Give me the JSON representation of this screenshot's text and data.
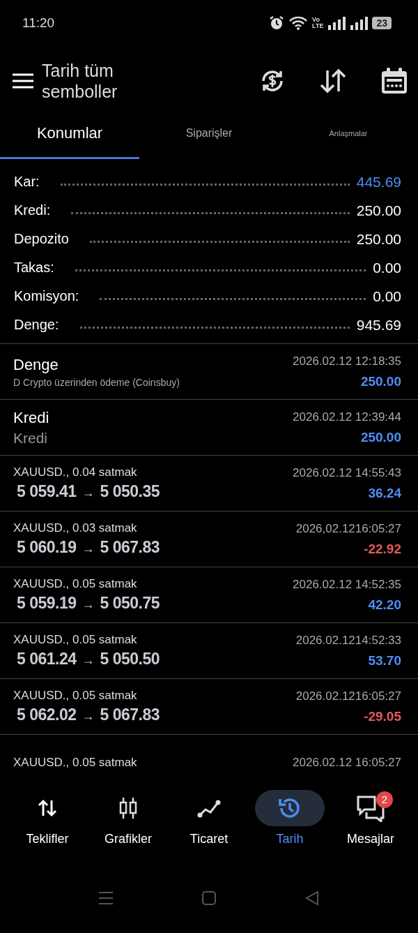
{
  "status_bar": {
    "time": "11:20",
    "network": [
      "Vo",
      "LTE"
    ],
    "battery": "23"
  },
  "header": {
    "title": "Tarih tüm semboller"
  },
  "tabs": [
    {
      "label": "Konumlar",
      "selected": true
    },
    {
      "label": "Siparişler",
      "selected": false
    },
    {
      "label": "Anlaşmalar",
      "selected": false
    }
  ],
  "summary": [
    {
      "label": "Kar:",
      "value": "445.69",
      "highlight": true
    },
    {
      "label": "Kredi:",
      "value": "250.00",
      "highlight": false
    },
    {
      "label": "Depozito",
      "value": "250.00",
      "highlight": false
    },
    {
      "label": "Takas:",
      "value": "0.00",
      "highlight": false
    },
    {
      "label": "Komisyon:",
      "value": "0.00",
      "highlight": false
    },
    {
      "label": "Denge:",
      "value": "945.69",
      "highlight": false
    }
  ],
  "entries": [
    {
      "kind": "balance",
      "title": "Denge",
      "comment": "D Crypto üzerinden ödeme (Coinsbuy)",
      "time": "2026.02.12 12:18:35",
      "amount": "250.00",
      "loss": false
    },
    {
      "kind": "credit",
      "title": "Kredi",
      "comment": "Kredi",
      "time": "2026.02.12 12:39:44",
      "amount": "250.00",
      "loss": false
    },
    {
      "kind": "trade",
      "title": "XAUUSD., 0.04 satmak",
      "open": "5 059.41",
      "arrow": "→",
      "close": "5 050.35",
      "time": "2026.02.12 14:55:43",
      "amount": "36.24",
      "loss": false
    },
    {
      "kind": "trade",
      "title": "XAUUSD., 0.03 satmak",
      "open": "5 060.19",
      "arrow": "→",
      "close": "5 067.83",
      "time": "2026,02.1216:05:27",
      "amount": "-22.92",
      "loss": true
    },
    {
      "kind": "trade",
      "title": "XAUUSD., 0.05 satmak",
      "open": "5 059.19",
      "arrow": "→",
      "close": "5 050.75",
      "time": "2026.02.12 14:52:35",
      "amount": "42.20",
      "loss": false
    },
    {
      "kind": "trade",
      "title": "XAUUSD., 0.05 satmak",
      "open": "5 061.24",
      "arrow": "→",
      "close": "5 050.50",
      "time": "2026.02.1214:52:33",
      "amount": "53.70",
      "loss": false
    },
    {
      "kind": "trade",
      "title": "XAUUSD., 0.05 satmak",
      "open": "5 062.02",
      "arrow": "→",
      "close": "5 067.83",
      "time": "2026.02.1216:05:27",
      "amount": "-29.05",
      "loss": true
    },
    {
      "kind": "trade",
      "title": "XAUUSD., 0.05 satmak",
      "time": "2026.02.12 16:05:27"
    }
  ],
  "bottom_nav": [
    {
      "label": "Teklifler",
      "kind": "quotes",
      "selected": false
    },
    {
      "label": "Grafikler",
      "kind": "charts",
      "selected": false
    },
    {
      "label": "Ticaret",
      "kind": "trade",
      "selected": false
    },
    {
      "label": "Tarih",
      "kind": "history",
      "selected": true
    },
    {
      "label": "Mesajlar",
      "kind": "messages",
      "selected": false,
      "badge": "2"
    }
  ]
}
